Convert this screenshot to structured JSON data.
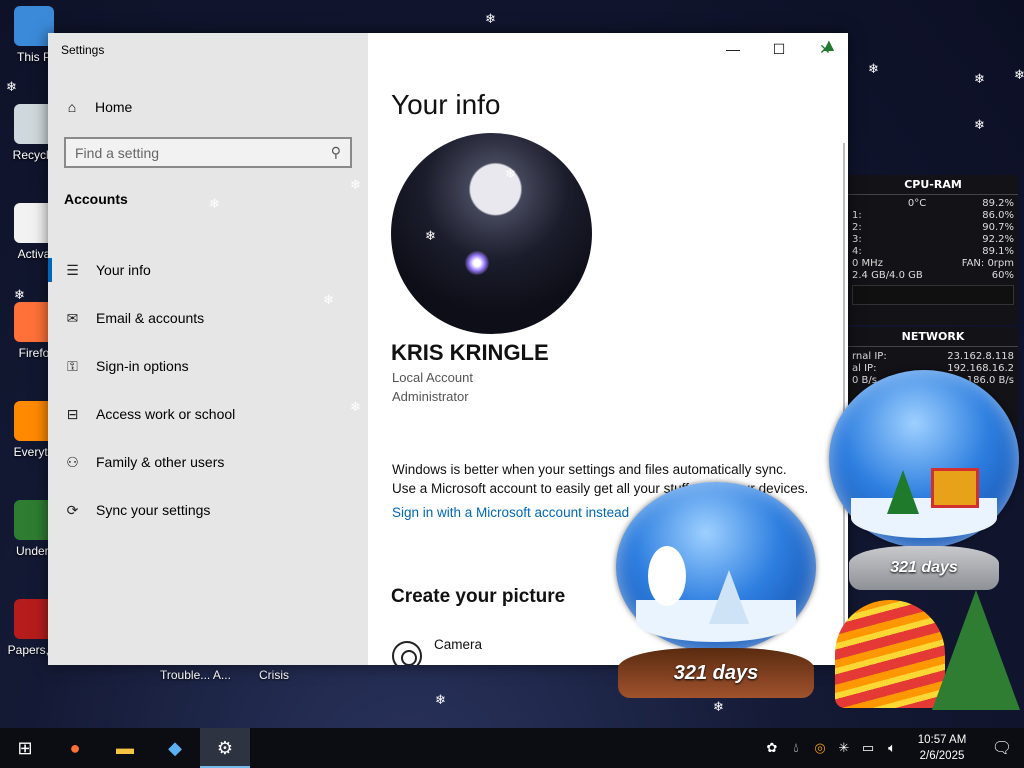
{
  "desktop": {
    "icons": [
      {
        "label": "This P",
        "color": "#3b8ad9"
      },
      {
        "label": "Recycle",
        "color": "#cfd8dc"
      },
      {
        "label": "Activa",
        "color": "#f2f2f2"
      },
      {
        "label": "Firefo",
        "color": "#ff7139"
      },
      {
        "label": "Everyth",
        "color": "#ff8a00"
      },
      {
        "label": "Undert",
        "color": "#2e7d32"
      },
      {
        "label": "Papers, P",
        "color": "#b71c1c"
      }
    ],
    "hidden_labels": [
      "Trouble... A...",
      "Crisis"
    ]
  },
  "window": {
    "title": "Settings",
    "minimize_glyph": "—",
    "maximize_glyph": "☐",
    "close_glyph": "✕"
  },
  "sidebar": {
    "home_label": "Home",
    "search_placeholder": "Find a setting",
    "section_label": "Accounts",
    "items": [
      {
        "label": "Your info",
        "icon": "person-card-icon",
        "glyph": "☰",
        "active": true
      },
      {
        "label": "Email & accounts",
        "icon": "mail-icon",
        "glyph": "✉",
        "active": false
      },
      {
        "label": "Sign-in options",
        "icon": "key-icon",
        "glyph": "⚿",
        "active": false
      },
      {
        "label": "Access work or school",
        "icon": "briefcase-icon",
        "glyph": "⊟",
        "active": false
      },
      {
        "label": "Family & other users",
        "icon": "add-person-icon",
        "glyph": "⚇",
        "active": false
      },
      {
        "label": "Sync your settings",
        "icon": "sync-icon",
        "glyph": "⟳",
        "active": false
      }
    ]
  },
  "main": {
    "title": "Your info",
    "user_name": "KRIS KRINGLE",
    "account_type": "Local Account",
    "role": "Administrator",
    "sync_message_line1": "Windows is better when your settings and files automatically sync.",
    "sync_message_line2": "Use a Microsoft account to easily get all your stuff on all your devices.",
    "ms_link": "Sign in with a Microsoft account instead",
    "section_title": "Create your picture",
    "camera_label": "Camera"
  },
  "widgets": {
    "cpu": {
      "title": "CPU-RAM",
      "temp": "0°C",
      "load": "89.2%",
      "cores": [
        {
          "label": "1:",
          "value": "86.0%"
        },
        {
          "label": "2:",
          "value": "90.7%"
        },
        {
          "label": "3:",
          "value": "92.2%"
        },
        {
          "label": "4:",
          "value": "89.1%"
        }
      ],
      "freq": "0 MHz",
      "fan": "FAN: 0rpm",
      "ram": "2.4 GB/4.0 GB",
      "ram_pct": "60%"
    },
    "network": {
      "title": "NETWORK",
      "rows": [
        {
          "label": "rnal IP:",
          "value": "23.162.8.118"
        },
        {
          "label": "al IP:",
          "value": "192.168.16.2"
        },
        {
          "label": "0 B/s",
          "value": "186.0 B/s"
        }
      ]
    }
  },
  "globes": {
    "left_days": "321 days",
    "right_days": "321 days"
  },
  "taskbar": {
    "time": "10:57 AM",
    "date": "2/6/2025"
  },
  "colors": {
    "accent": "#0067b8",
    "sidebar_bg": "#e6e6e6",
    "taskbar_bg": "#0b0d12"
  }
}
